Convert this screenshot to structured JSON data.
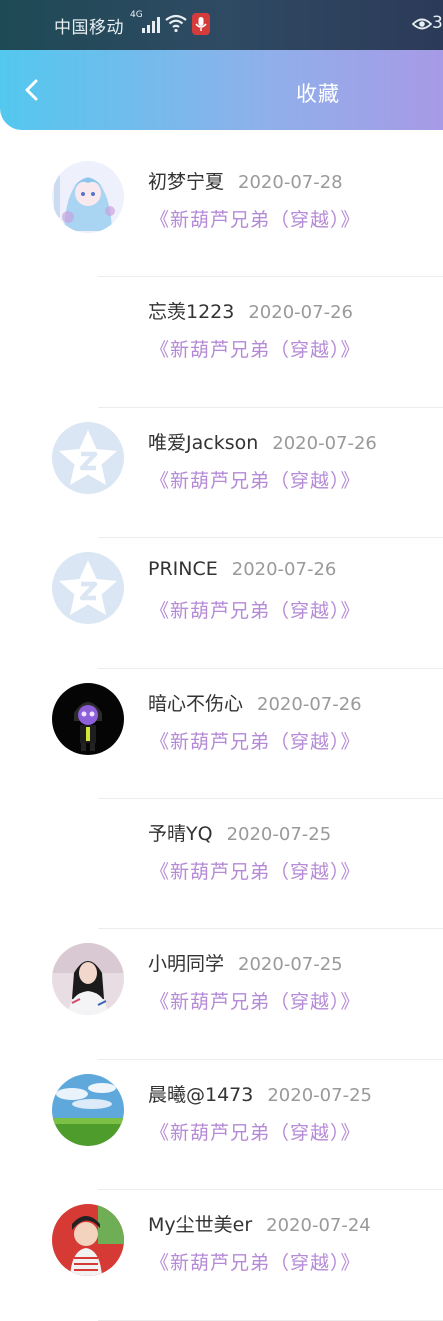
{
  "status_bar": {
    "carrier": "中国移动",
    "network": "4G",
    "right_text": "3"
  },
  "header": {
    "title": "收藏"
  },
  "items": [
    {
      "name": "初梦宁夏",
      "date": "2020-07-28",
      "work": "《新葫芦兄弟（穿越）》",
      "avatar": "anime-girl-avatar"
    },
    {
      "name": "忘羡1223",
      "date": "2020-07-26",
      "work": "《新葫芦兄弟（穿越）》",
      "avatar": "none"
    },
    {
      "name": "唯爱Jackson",
      "date": "2020-07-26",
      "work": "《新葫芦兄弟（穿越）》",
      "avatar": "default-qq-avatar"
    },
    {
      "name": "PRINCE",
      "date": "2020-07-26",
      "work": "《新葫芦兄弟（穿越）》",
      "avatar": "default-qq-avatar"
    },
    {
      "name": "暗心不伤心",
      "date": "2020-07-26",
      "work": "《新葫芦兄弟（穿越）》",
      "avatar": "dark-character-avatar"
    },
    {
      "name": "予晴YQ",
      "date": "2020-07-25",
      "work": "《新葫芦兄弟（穿越）》",
      "avatar": "none"
    },
    {
      "name": "小明同学",
      "date": "2020-07-25",
      "work": "《新葫芦兄弟（穿越）》",
      "avatar": "girl-photo-avatar"
    },
    {
      "name": "晨曦@1473",
      "date": "2020-07-25",
      "work": "《新葫芦兄弟（穿越）》",
      "avatar": "landscape-avatar"
    },
    {
      "name": "My尘世美er",
      "date": "2020-07-24",
      "work": "《新葫芦兄弟（穿越）》",
      "avatar": "cartoon-red-avatar"
    }
  ]
}
